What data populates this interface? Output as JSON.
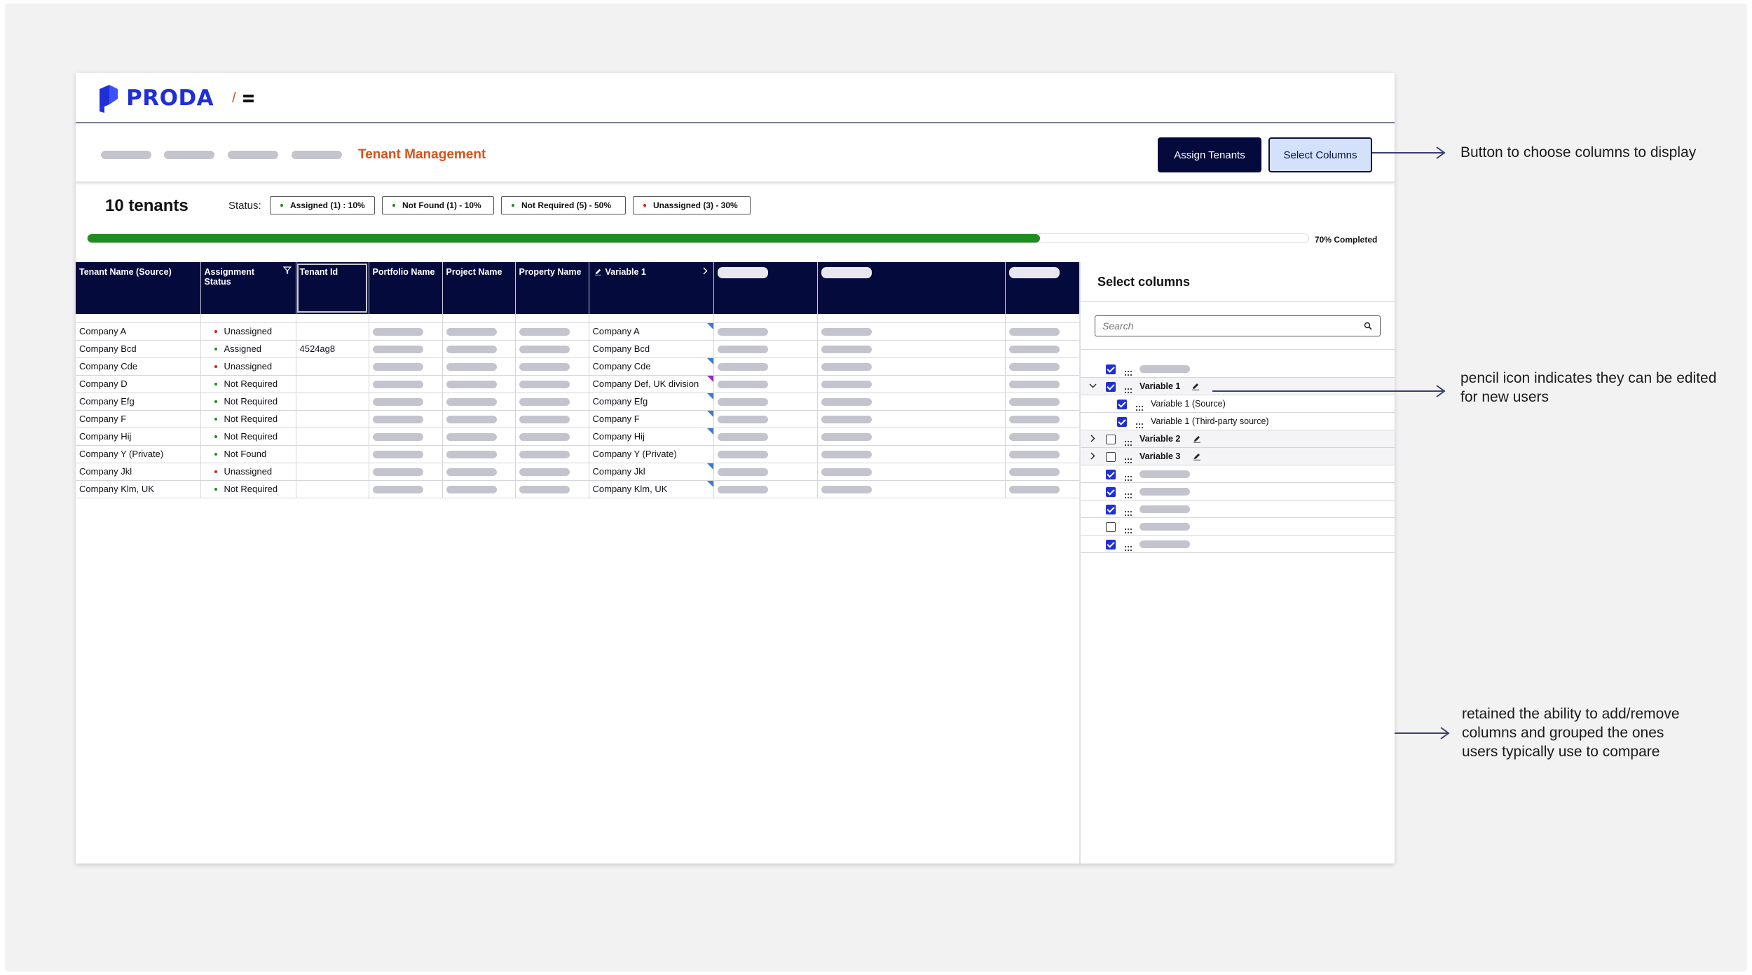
{
  "app": {
    "logo": "PRODA",
    "slash": "/"
  },
  "header": {
    "title": "Tenant Management",
    "assign_label": "Assign Tenants",
    "select_label": "Select Columns"
  },
  "summary": {
    "count": "10 tenants",
    "status_label": "Status:",
    "chips": [
      {
        "label": "Assigned (1) : 10%",
        "color": "#1e8c1e"
      },
      {
        "label": "Not Found (1) - 10%",
        "color": "#1e8c1e"
      },
      {
        "label": "Not Required (5) - 50%",
        "color": "#1e8c1e"
      },
      {
        "label": "Unassigned (3) - 30%",
        "color": "#d81b1b"
      }
    ],
    "progress": 0.78,
    "progress_text": "70% Completed"
  },
  "table": {
    "headers": [
      "Tenant Name (Source)",
      "Assignment Status",
      "Tenant Id",
      "Portfolio Name",
      "Project Name",
      "Property Name",
      "Variable 1"
    ],
    "rows": [
      {
        "name": "Company A",
        "status": "Unassigned",
        "status_color": "#d81b1b",
        "tenant_id": "",
        "variable": "Company A",
        "flag": "blue"
      },
      {
        "name": "Company Bcd",
        "status": "Assigned",
        "status_color": "#1e8c1e",
        "tenant_id": "4524ag8",
        "variable": "Company Bcd",
        "flag": ""
      },
      {
        "name": "Company Cde",
        "status": "Unassigned",
        "status_color": "#d81b1b",
        "tenant_id": "",
        "variable": "Company Cde",
        "flag": "blue"
      },
      {
        "name": "Company D",
        "status": "Not Required",
        "status_color": "#1e8c1e",
        "tenant_id": "",
        "variable": "Company Def, UK division",
        "flag": "purple"
      },
      {
        "name": "Company Efg",
        "status": "Not Required",
        "status_color": "#1e8c1e",
        "tenant_id": "",
        "variable": "Company Efg",
        "flag": "blue"
      },
      {
        "name": "Company F",
        "status": "Not Required",
        "status_color": "#1e8c1e",
        "tenant_id": "",
        "variable": "Company F",
        "flag": "blue"
      },
      {
        "name": "Company Hij",
        "status": "Not Required",
        "status_color": "#1e8c1e",
        "tenant_id": "",
        "variable": "Company Hij",
        "flag": "blue"
      },
      {
        "name": "Company Y (Private)",
        "status": "Not Found",
        "status_color": "#1e8c1e",
        "tenant_id": "",
        "variable": "Company Y (Private)",
        "flag": ""
      },
      {
        "name": "Company Jkl",
        "status": "Unassigned",
        "status_color": "#d81b1b",
        "tenant_id": "",
        "variable": "Company Jkl",
        "flag": "blue"
      },
      {
        "name": "Company Klm, UK",
        "status": "Not Required",
        "status_color": "#1e8c1e",
        "tenant_id": "",
        "variable": "Company Klm, UK",
        "flag": "blue"
      }
    ]
  },
  "panel": {
    "title": "Select columns",
    "search_placeholder": "Search",
    "items": [
      {
        "label": "",
        "checked": true,
        "level": 0,
        "expander": "",
        "editable": false,
        "bold": false
      },
      {
        "label": "Variable 1",
        "checked": true,
        "level": 0,
        "expander": "open",
        "editable": true,
        "bold": true
      },
      {
        "label": "Variable 1 (Source)",
        "checked": true,
        "level": 1,
        "expander": "",
        "editable": false,
        "bold": false
      },
      {
        "label": "Variable 1 (Third-party source)",
        "checked": true,
        "level": 1,
        "expander": "",
        "editable": false,
        "bold": false
      },
      {
        "label": "Variable 2",
        "checked": false,
        "level": 0,
        "expander": "closed",
        "editable": true,
        "bold": true
      },
      {
        "label": "Variable 3",
        "checked": false,
        "level": 0,
        "expander": "closed",
        "editable": true,
        "bold": true
      },
      {
        "label": "",
        "checked": true,
        "level": 0,
        "expander": "",
        "editable": false,
        "bold": false
      },
      {
        "label": "",
        "checked": true,
        "level": 0,
        "expander": "",
        "editable": false,
        "bold": false
      },
      {
        "label": "",
        "checked": true,
        "level": 0,
        "expander": "",
        "editable": false,
        "bold": false
      },
      {
        "label": "",
        "checked": false,
        "level": 0,
        "expander": "",
        "editable": false,
        "bold": false
      },
      {
        "label": "",
        "checked": true,
        "level": 0,
        "expander": "",
        "editable": false,
        "bold": false
      }
    ]
  },
  "annotations": {
    "select_columns": "Button to choose columns to display",
    "pencil_line1": "pencil icon indicates they can be edited",
    "pencil_line2": "for new users",
    "retained_line1": "retained the ability to add/remove",
    "retained_line2": "columns and grouped the ones",
    "retained_line3": "users typically use to compare"
  },
  "icons": [
    "proda-logo-icon",
    "menu-icon",
    "filter-icon",
    "chevron-right-icon",
    "pencil-icon",
    "search-icon",
    "drag-handle-icon",
    "chevron-down-icon",
    "arrow-right-icon"
  ]
}
